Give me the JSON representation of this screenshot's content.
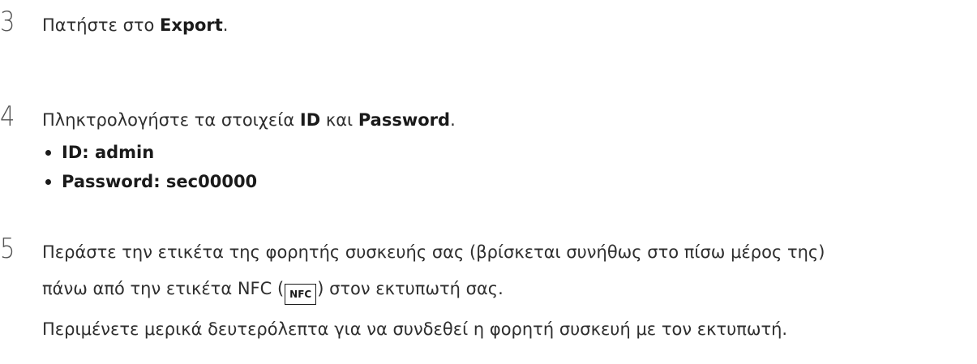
{
  "steps": [
    {
      "number": "3",
      "text_before": "Πατήστε στο ",
      "bold": "Export",
      "text_after": "."
    },
    {
      "number": "4",
      "text_before": "Πληκτρολογήστε τα στοιχεία ",
      "bold_1": "ID",
      "text_middle": " και ",
      "bold_2": "Password",
      "text_after": ".",
      "bullets": [
        "ID: admin",
        "Password: sec00000"
      ]
    },
    {
      "number": "5",
      "line1": "Περάστε την ετικέτα της φορητής συσκευής σας (βρίσκεται συνήθως στο πίσω μέρος της)",
      "line2_before": "πάνω από την ετικέτα NFC (",
      "nfc_icon_label": "NFC",
      "line2_after": ") στον εκτυπωτή σας.",
      "note": "Περιμένετε μερικά δευτερόλεπτα για να συνδεθεί η φορητή συσκευή με τον εκτυπωτή."
    }
  ]
}
